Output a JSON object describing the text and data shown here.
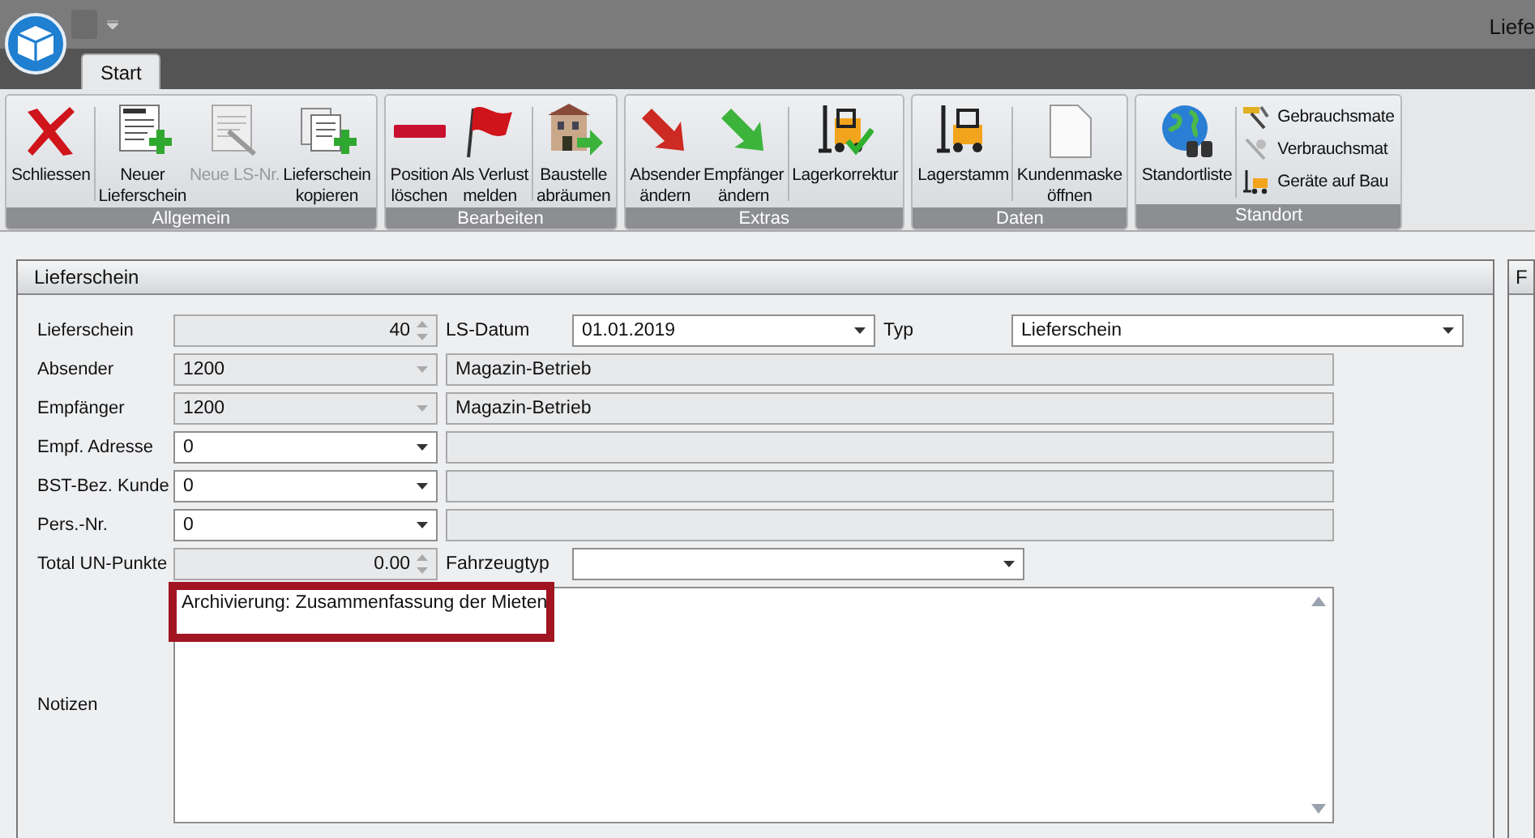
{
  "window": {
    "title": "Liefe"
  },
  "tabs": [
    {
      "label": "Start",
      "selected": true
    }
  ],
  "ribbon": {
    "groups": [
      {
        "label": "Allgemein",
        "buttons": [
          {
            "kind": "large",
            "label": "Schliessen",
            "disabled": false
          },
          {
            "kind": "large",
            "label": "Neuer\nLieferschein",
            "disabled": false
          },
          {
            "kind": "large",
            "label": "Neue LS-Nr.",
            "disabled": true
          },
          {
            "kind": "large",
            "label": "Lieferschein\nkopieren",
            "disabled": false
          }
        ]
      },
      {
        "label": "Bearbeiten",
        "buttons": [
          {
            "kind": "large",
            "label": "Position\nlöschen",
            "disabled": false
          },
          {
            "kind": "large",
            "label": "Als Verlust\nmelden",
            "disabled": false
          },
          {
            "kind": "large",
            "label": "Baustelle\nabräumen",
            "disabled": false
          }
        ]
      },
      {
        "label": "Extras",
        "buttons": [
          {
            "kind": "large",
            "label": "Absender\nändern",
            "disabled": false
          },
          {
            "kind": "large",
            "label": "Empfänger\nändern",
            "disabled": false
          },
          {
            "kind": "large",
            "label": "Lagerkorrektur",
            "disabled": false
          }
        ]
      },
      {
        "label": "Daten",
        "buttons": [
          {
            "kind": "large",
            "label": "Lagerstamm",
            "disabled": false
          },
          {
            "kind": "large",
            "label": "Kundenmaske\nöffnen",
            "disabled": false
          }
        ]
      },
      {
        "label": "Standort",
        "buttons": [
          {
            "kind": "large",
            "label": "Standortliste",
            "disabled": false
          },
          {
            "kind": "small",
            "label": "Gebrauchsmate",
            "disabled": false
          },
          {
            "kind": "small",
            "label": "Verbrauchsmat",
            "disabled": false
          },
          {
            "kind": "small",
            "label": "Geräte auf Bau",
            "disabled": false
          }
        ]
      }
    ]
  },
  "panel": {
    "title": "Lieferschein",
    "rows": [
      {
        "label": "Lieferschein",
        "fields": [
          {
            "kind": "spin",
            "value": "40",
            "disabled": true
          },
          {
            "kind": "label",
            "text": "LS-Datum"
          },
          {
            "kind": "combo",
            "value": "01.01.2019",
            "disabled": false
          },
          {
            "kind": "label",
            "text": "Typ"
          },
          {
            "kind": "combo",
            "value": "Lieferschein",
            "disabled": false
          }
        ]
      },
      {
        "label": "Absender",
        "fields": [
          {
            "kind": "combo",
            "value": "1200",
            "disabled": true
          },
          {
            "kind": "text",
            "value": "Magazin-Betrieb",
            "disabled": true
          }
        ]
      },
      {
        "label": "Empfänger",
        "fields": [
          {
            "kind": "combo",
            "value": "1200",
            "disabled": true
          },
          {
            "kind": "text",
            "value": "Magazin-Betrieb",
            "disabled": true
          }
        ]
      },
      {
        "label": "Empf. Adresse",
        "fields": [
          {
            "kind": "combo",
            "value": "0",
            "disabled": false
          },
          {
            "kind": "text",
            "disabled": true
          }
        ]
      },
      {
        "label": "BST-Bez. Kunde",
        "fields": [
          {
            "kind": "combo",
            "value": "0",
            "disabled": false
          },
          {
            "kind": "text",
            "disabled": true
          }
        ]
      },
      {
        "label": "Pers.-Nr.",
        "fields": [
          {
            "kind": "combo",
            "value": "0",
            "disabled": false
          },
          {
            "kind": "text",
            "disabled": true
          }
        ]
      },
      {
        "label": "Total UN-Punkte",
        "fields": [
          {
            "kind": "spin",
            "value": "0.00",
            "disabled": true
          },
          {
            "kind": "label",
            "text": "Fahrzeugtyp"
          },
          {
            "kind": "combo",
            "disabled": false
          }
        ]
      }
    ],
    "notes": {
      "label": "Notizen",
      "value": "Archivierung: Zusammenfassung der Mieten",
      "focused": true,
      "highlighted": true
    }
  },
  "side_panel": {
    "title": "F"
  }
}
